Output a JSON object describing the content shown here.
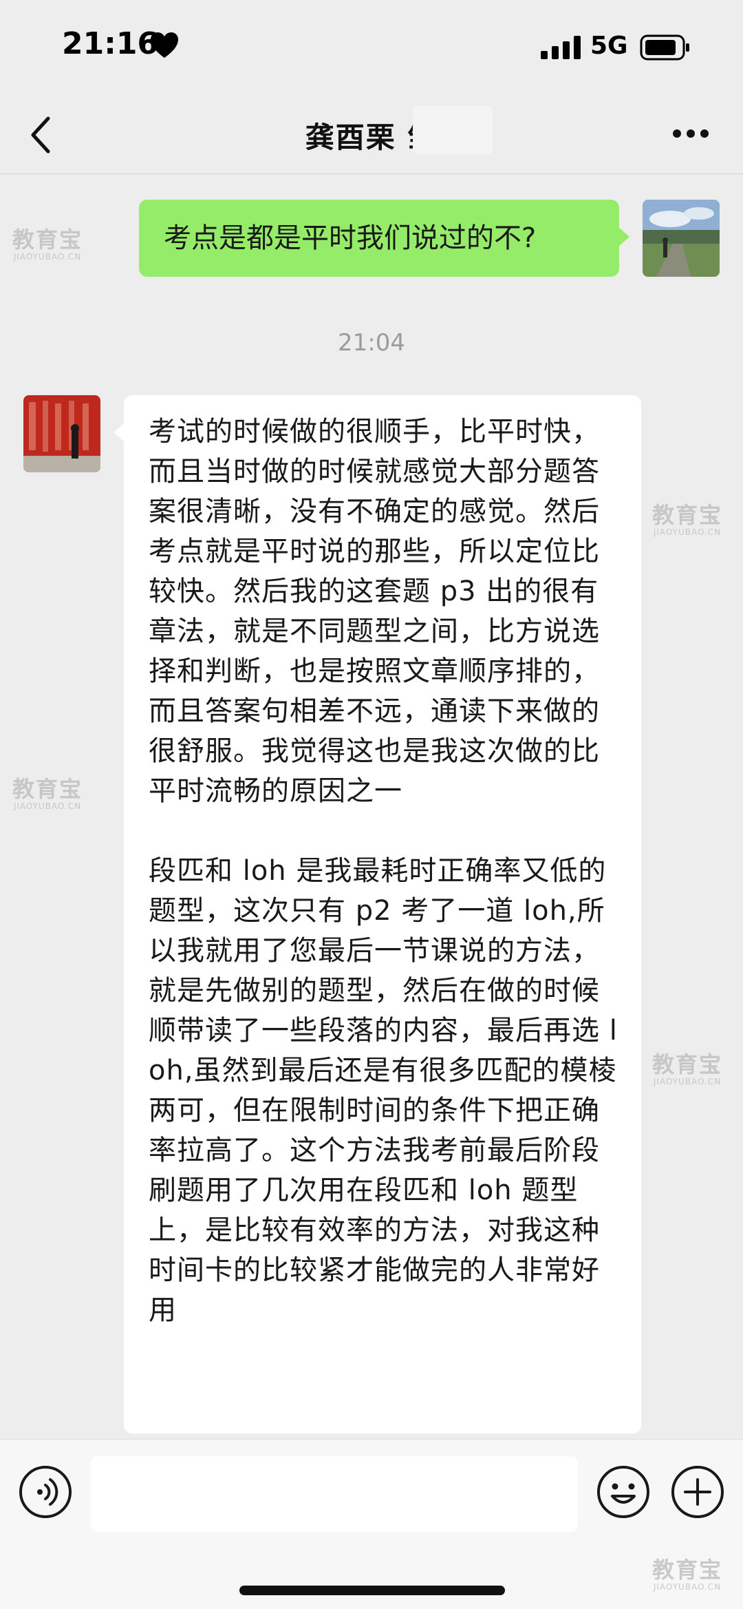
{
  "status_bar": {
    "time": "21:16",
    "network": "5G"
  },
  "header": {
    "title": "龚酉栗 邹"
  },
  "messages": {
    "outgoing_text": "考点是都是平时我们说过的不?",
    "timestamp": "21:04",
    "incoming_paragraph_1": "考试的时候做的很顺手，比平时快，而且当时做的时候就感觉大部分题答案很清晰，没有不确定的感觉。然后考点就是平时说的那些，所以定位比较快。然后我的这套题 p3 出的很有章法，就是不同题型之间，比方说选择和判断，也是按照文章顺序排的，而且答案句相差不远，通读下来做的很舒服。我觉得这也是我这次做的比平时流畅的原因之一",
    "incoming_paragraph_2": "段匹和 loh 是我最耗时正确率又低的题型，这次只有 p2 考了一道 loh,所以我就用了您最后一节课说的方法，就是先做别的题型，然后在做的时候顺带读了一些段落的内容，最后再选 loh,虽然到最后还是有很多匹配的模棱两可，但在限制时间的条件下把正确率拉高了。这个方法我考前最后阶段刷题用了几次用在段匹和 loh 题型上，是比较有效率的方法，对我这种时间卡的比较紧才能做完的人非常好用"
  },
  "watermark": {
    "cn": "教育宝",
    "en": "JIAOYUBAO.CN"
  },
  "colors": {
    "outgoing_bubble": "#95ec69",
    "incoming_bubble": "#ffffff",
    "background": "#ededed"
  },
  "icons": [
    "heart-icon",
    "signal-icon",
    "battery-icon",
    "back-icon",
    "more-icon",
    "voice-icon",
    "emoji-icon",
    "plus-icon"
  ]
}
